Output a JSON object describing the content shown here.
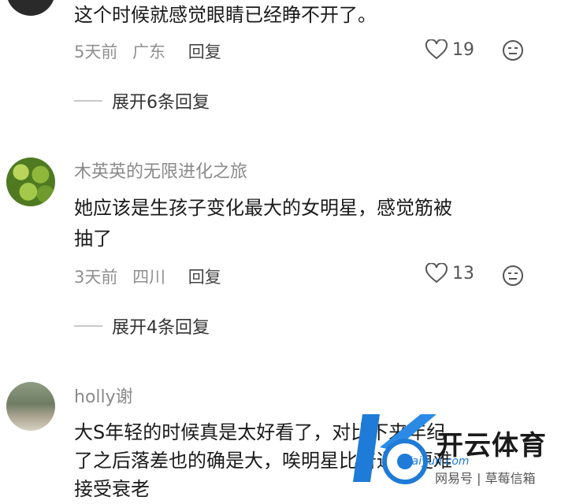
{
  "comments": [
    {
      "text": "这个时候就感觉眼睛已经睁不开了。",
      "time": "5天前",
      "location": "广东",
      "reply_label": "回复",
      "likes": "19",
      "expand_label": "展开6条回复"
    },
    {
      "username": "木英英的无限进化之旅",
      "text_line1": "她应该是生孩子变化最大的女明星，感觉筋被",
      "text_line2": "抽了",
      "time": "3天前",
      "location": "四川",
      "reply_label": "回复",
      "likes": "13",
      "expand_label": "展开4条回复"
    },
    {
      "username": "holly谢",
      "text_line1": "大S年轻的时候真是太好看了，对比下来年纪",
      "text_line2": "了之后落差也的确是大，唉明星比普通人更难",
      "text_line3": "接受衰老"
    }
  ],
  "watermark": {
    "brand": "开云体育",
    "url": "Kaiyun.com",
    "sub": "网易号 | 草莓信箱"
  },
  "icons": [
    "heart-icon",
    "dislike-face-icon",
    "kaiyun-logo"
  ]
}
